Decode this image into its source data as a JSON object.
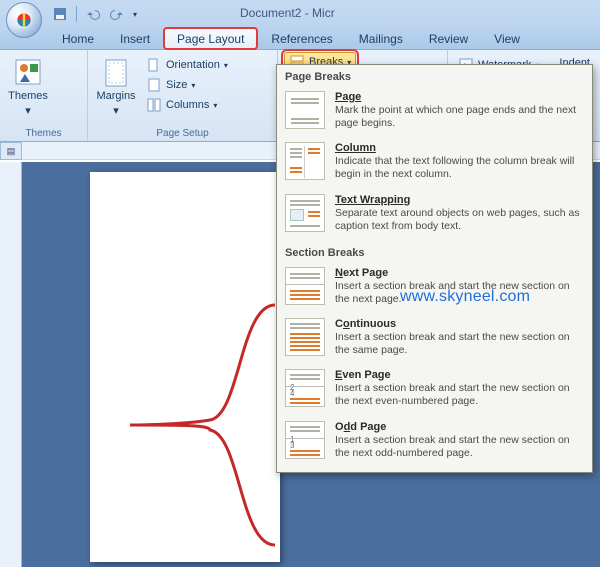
{
  "window": {
    "title": "Document2 - Micr"
  },
  "tabs": [
    "Home",
    "Insert",
    "Page Layout",
    "References",
    "Mailings",
    "Review",
    "View"
  ],
  "active_tab_index": 2,
  "ribbon": {
    "themes_group": {
      "label": "Themes",
      "themes": "Themes"
    },
    "page_setup_group": {
      "label": "Page Setup",
      "margins": "Margins",
      "orientation": "Orientation",
      "size": "Size",
      "columns": "Columns",
      "breaks": "Breaks"
    },
    "right": {
      "watermark": "Watermark",
      "indent": "Indent"
    }
  },
  "dropdown": {
    "page_breaks_header": "Page Breaks",
    "section_breaks_header": "Section Breaks",
    "items": {
      "page": {
        "title": "Page",
        "desc": "Mark the point at which one page ends and the next page begins."
      },
      "column": {
        "title": "Column",
        "desc": "Indicate that the text following the column break will begin in the next column."
      },
      "textwrap": {
        "title": "Text Wrapping",
        "desc": "Separate text around objects on web pages, such as caption text from body text."
      },
      "nextpage": {
        "title": "Next Page",
        "desc": "Insert a section break and start the new section on the next page."
      },
      "continuous": {
        "title": "Continuous",
        "desc": "Insert a section break and start the new section on the same page."
      },
      "evenpage": {
        "title": "Even Page",
        "desc": "Insert a section break and start the new section on the next even-numbered page."
      },
      "oddpage": {
        "title": "Odd Page",
        "desc": "Insert a section break and start the new section on the next odd-numbered page."
      }
    }
  },
  "annotation": {
    "watermark_url": "www.skyneel.com"
  },
  "colors": {
    "accent": "#e03a3a",
    "ribbon_blue": "#bcd4ee"
  }
}
